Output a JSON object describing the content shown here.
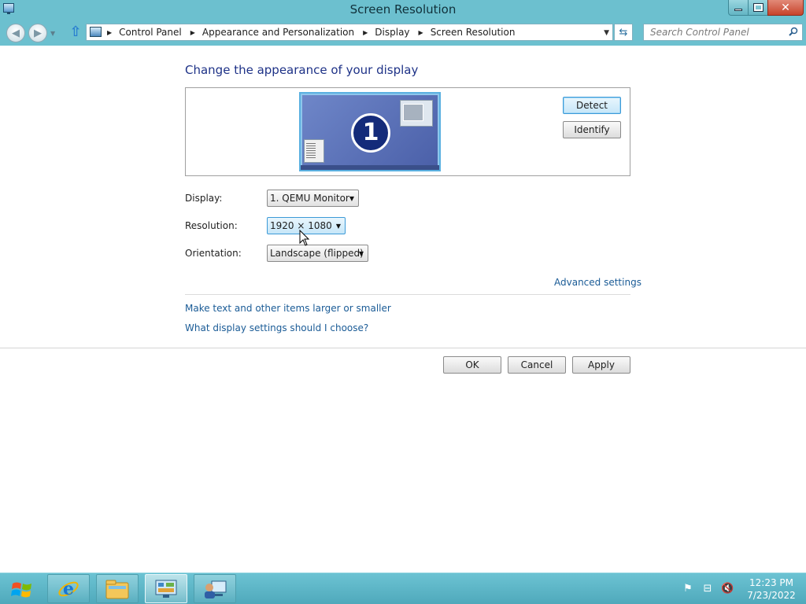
{
  "window": {
    "title": "Screen Resolution"
  },
  "address_bar": {
    "crumbs": [
      "Control Panel",
      "Appearance and Personalization",
      "Display",
      "Screen Resolution"
    ]
  },
  "search": {
    "placeholder": "Search Control Panel"
  },
  "main": {
    "title": "Change the appearance of your display",
    "monitor_number": "1",
    "detect_label": "Detect",
    "identify_label": "Identify",
    "display_label": "Display:",
    "display_value": "1. QEMU Monitor",
    "resolution_label": "Resolution:",
    "resolution_value": "1920 × 1080",
    "orientation_label": "Orientation:",
    "orientation_value": "Landscape (flipped)",
    "advanced_link": "Advanced settings",
    "text_size_link": "Make text and other items larger or smaller",
    "help_link": "What display settings should I choose?"
  },
  "buttons": {
    "ok": "OK",
    "cancel": "Cancel",
    "apply": "Apply"
  },
  "taskbar": {
    "items": [
      "internet-explorer-icon",
      "file-explorer-icon",
      "control-panel-icon",
      "network-icon"
    ],
    "clock_time": "12:23 PM",
    "clock_date": "7/23/2022"
  },
  "colors": {
    "accent": "#6cc0cf",
    "link": "#1a5b96",
    "title": "#1e3287"
  }
}
